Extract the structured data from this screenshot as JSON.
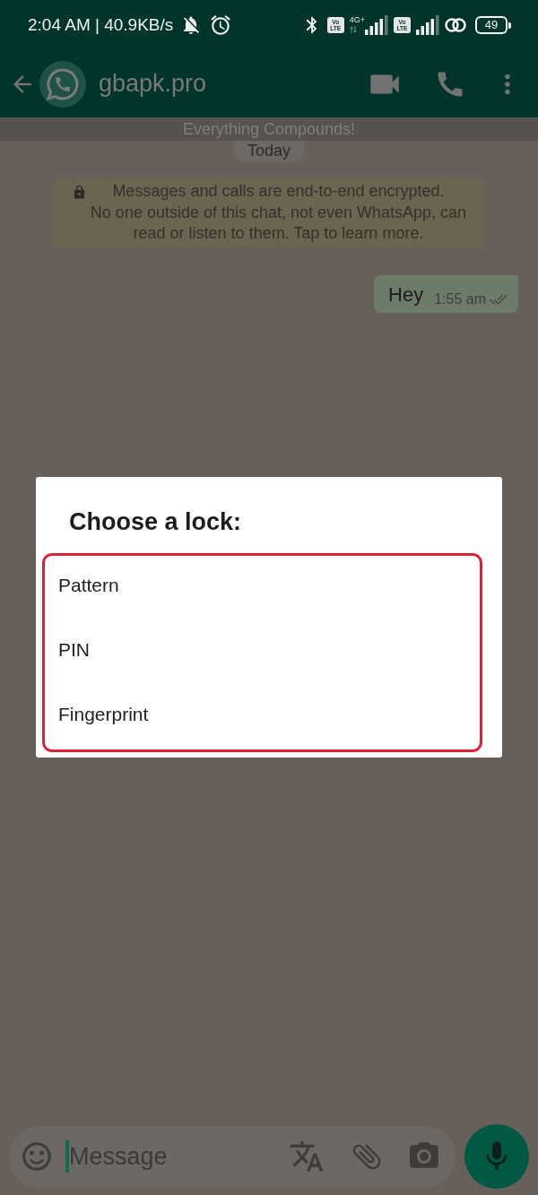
{
  "status_bar": {
    "time": "2:04 AM | 40.9KB/s",
    "sims": [
      {
        "badge_top": "Vo",
        "badge_bottom": "LTE",
        "network_type": "4G+"
      },
      {
        "badge_top": "Vo",
        "badge_bottom": "LTE"
      }
    ],
    "battery": "49"
  },
  "chat_header": {
    "title": "gbapk.pro"
  },
  "banner": {
    "text": "Everything Compounds!"
  },
  "chat": {
    "date_chip": "Today",
    "encryption_notice": "Messages and calls are end-to-end encrypted.\nNo one outside of this chat, not even WhatsApp, can\nread or listen to them. Tap to learn more.",
    "messages": [
      {
        "text": "Hey",
        "time": "1:55 am",
        "outgoing": true,
        "delivered": true,
        "read": false
      }
    ]
  },
  "dialog": {
    "title": "Choose a lock:",
    "options": [
      {
        "label": "Pattern"
      },
      {
        "label": "PIN"
      },
      {
        "label": "Fingerprint"
      }
    ]
  },
  "composer": {
    "placeholder": "Message"
  }
}
